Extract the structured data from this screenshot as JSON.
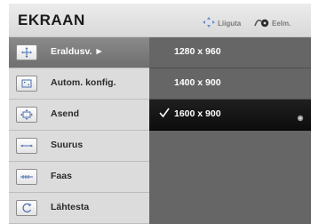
{
  "header": {
    "title": "EKRAAN",
    "hint_move": "Liiguta",
    "hint_back": "Eelm."
  },
  "menu": {
    "items": [
      {
        "label": "Eraldusv. ►",
        "icon": "resolution-icon",
        "active": true
      },
      {
        "label": "Autom. konfig.",
        "icon": "auto-config-icon",
        "active": false
      },
      {
        "label": "Asend",
        "icon": "position-icon",
        "active": false
      },
      {
        "label": "Suurus",
        "icon": "size-icon",
        "active": false
      },
      {
        "label": "Faas",
        "icon": "phase-icon",
        "active": false
      },
      {
        "label": "Lähtesta",
        "icon": "reset-icon",
        "active": false
      }
    ]
  },
  "resolutions": {
    "options": [
      {
        "label": "1280 x 960",
        "selected": false
      },
      {
        "label": "1400 x 900",
        "selected": false
      },
      {
        "label": "1600 x 900",
        "selected": true
      }
    ]
  },
  "colors": {
    "active_item": "#7c7c7c",
    "selected_option": "#151515",
    "option_panel": "#666666"
  }
}
